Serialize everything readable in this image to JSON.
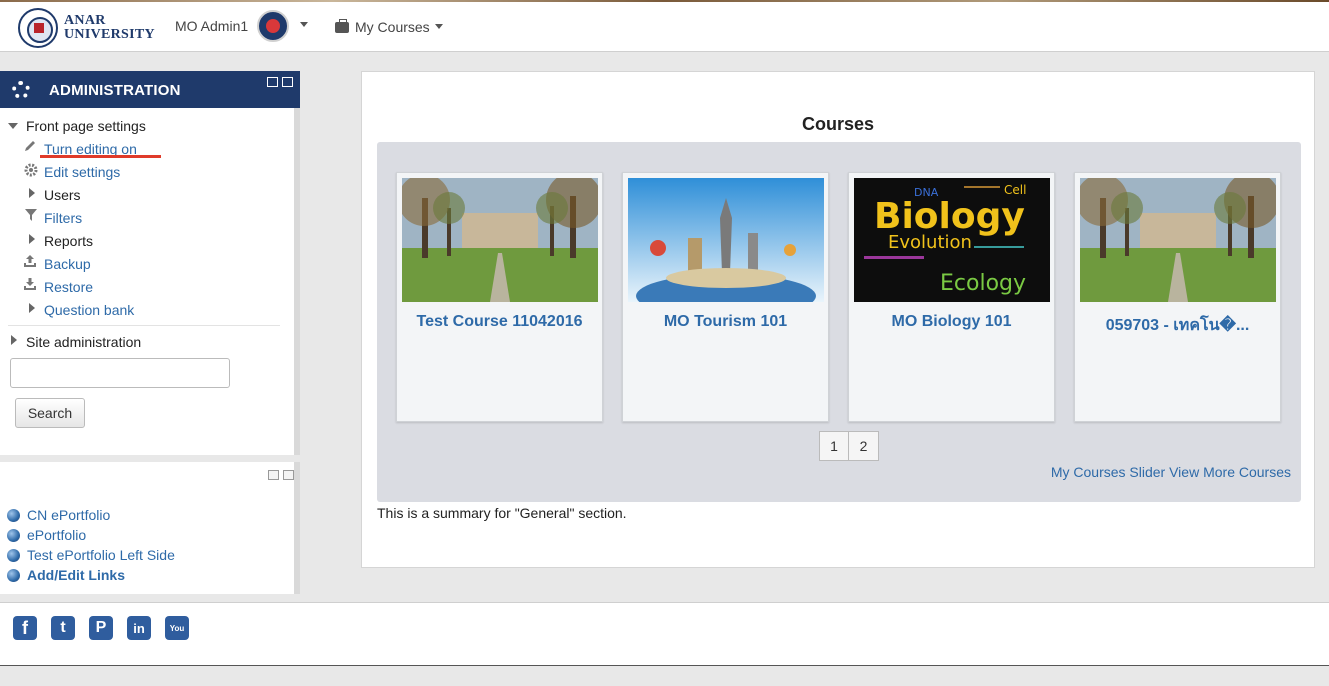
{
  "header": {
    "logo_line1": "ANAR",
    "logo_line2": "UNIVERSITY",
    "user_name": "MO Admin1",
    "my_courses_label": "My Courses"
  },
  "admin": {
    "title": "ADMINISTRATION",
    "front_page_settings": "Front page settings",
    "items": [
      {
        "label": "Turn editing on",
        "icon": "pencil-icon",
        "type": "link"
      },
      {
        "label": "Edit settings",
        "icon": "gear-icon",
        "type": "link"
      },
      {
        "label": "Users",
        "icon": "expand-arrow-icon",
        "type": "plain"
      },
      {
        "label": "Filters",
        "icon": "filter-icon",
        "type": "link"
      },
      {
        "label": "Reports",
        "icon": "expand-arrow-icon",
        "type": "plain"
      },
      {
        "label": "Backup",
        "icon": "upload-icon",
        "type": "link"
      },
      {
        "label": "Restore",
        "icon": "download-icon",
        "type": "link"
      },
      {
        "label": "Question bank",
        "icon": "expand-arrow-icon",
        "type": "link"
      }
    ],
    "site_administration": "Site administration",
    "search_value": "",
    "search_button": "Search"
  },
  "links": {
    "items": [
      "CN ePortfolio",
      "ePortfolio",
      "Test ePortfolio Left Side",
      "Add/Edit Links"
    ]
  },
  "main": {
    "heading": "Courses",
    "courses": [
      {
        "title": "Test Course 11042016",
        "image": "campus-photo"
      },
      {
        "title": "MO Tourism 101",
        "image": "travel-landmarks"
      },
      {
        "title": "MO Biology 101",
        "image": "biology-word-cloud"
      },
      {
        "title": "059703 - เทคโน�...",
        "image": "campus-photo"
      }
    ],
    "pages": [
      "1",
      "2"
    ],
    "more_link": "My Courses Slider View More Courses",
    "summary": "This is a summary for \"General\" section.",
    "biology_words": [
      "Biology",
      "Evolution",
      "Ecology",
      "DNA",
      "Cell"
    ]
  },
  "footer": {
    "social": [
      {
        "name": "facebook-icon",
        "glyph": "f"
      },
      {
        "name": "twitter-icon",
        "glyph": "t"
      },
      {
        "name": "pinterest-icon",
        "glyph": "P"
      },
      {
        "name": "linkedin-icon",
        "glyph": "in"
      },
      {
        "name": "youtube-icon",
        "glyph": "You"
      }
    ]
  },
  "colors": {
    "brand_navy": "#1f3a6b",
    "link_blue": "#2e6aa8",
    "highlight_red": "#e03b2a"
  }
}
